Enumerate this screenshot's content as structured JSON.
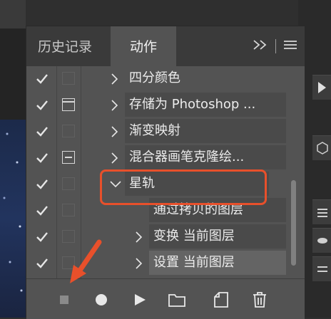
{
  "panel": {
    "tabs": [
      {
        "label": "历史记录"
      },
      {
        "label": "动作"
      }
    ]
  },
  "actions": [
    {
      "label": "四分颜色"
    },
    {
      "label": "存储为 Photoshop ..."
    },
    {
      "label": "渐变映射"
    },
    {
      "label": "混合器画笔克隆绘..."
    },
    {
      "label": "星轨"
    },
    {
      "label": "通过拷贝的图层"
    },
    {
      "label": "变换 当前图层"
    },
    {
      "label": "设置 当前图层"
    }
  ],
  "icons": {
    "check": "checkmark-icon",
    "expand": "chevron-right-icon",
    "collapse": "chevron-down-icon",
    "stop": "stop-icon",
    "record": "record-icon",
    "play": "play-icon",
    "new_set": "folder-icon",
    "new_action": "new-item-icon",
    "delete": "trash-icon"
  },
  "colors": {
    "annotation": "#e8502b"
  }
}
